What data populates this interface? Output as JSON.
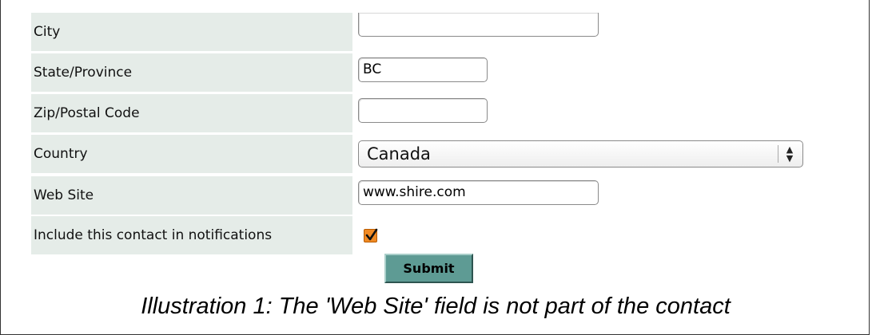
{
  "form": {
    "rows": [
      {
        "label": "City",
        "value": ""
      },
      {
        "label": "State/Province",
        "value": "BC"
      },
      {
        "label": "Zip/Postal Code",
        "value": ""
      },
      {
        "label": "Country",
        "value": "Canada"
      },
      {
        "label": "Web Site",
        "value": "www.shire.com"
      },
      {
        "label": "Include this contact in notifications",
        "checked": true
      }
    ],
    "submit_label": "Submit"
  },
  "caption": "Illustration 1: The 'Web Site' field is not part of the contact",
  "colors": {
    "label_bg": "#e5ece8",
    "submit_bg": "#5e9b94",
    "checkbox": "#f08a24"
  }
}
